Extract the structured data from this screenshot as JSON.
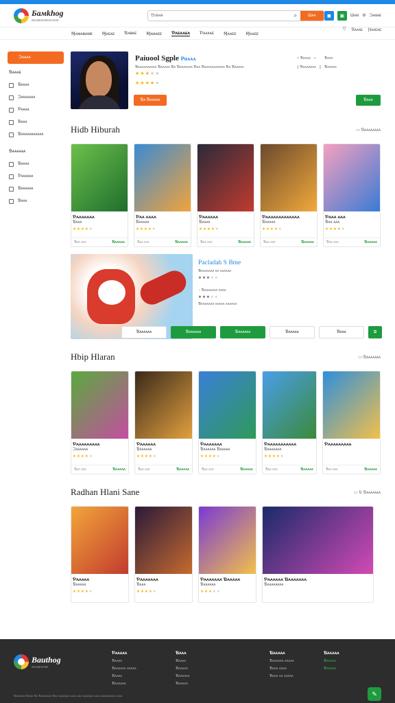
{
  "header": {
    "logo_text": "Бaмkhog",
    "logo_sub": "ʙᴇᴀᴍᴇʀᴀᴍᴇᴡᴀɢᴇᴍ",
    "search_placeholder": "Ծɑᴃᴀᴃ",
    "search_button": "Ɯᴀᴀ",
    "right_labels": [
      "Ɯᴀᴍ",
      "Ɔᴀᴍᴀᴇ"
    ]
  },
  "nav": {
    "items": [
      "Ɱᴀᴍᴀᴃᴀᴍᴇ",
      "Ɱᴀᴇᴀᴇ",
      "Ɓᴀᴃᴀᴇ",
      "Ɱᴀᴍᴀᴇᴇ",
      "Ƥᴀᴇᴀᴀᴇᴀ",
      "Ƥᴀᴀᴀᴀᴇ",
      "Ɱᴀᴀᴇᴇ",
      "Ɱᴀᴀᴇᴇ"
    ],
    "active_index": 4,
    "right": [
      "Ɓᴀᴀᴀᴇ",
      "Ɲᴀᴀᴇᴀᴇ"
    ]
  },
  "sidebar": {
    "active": "Ɔᴀᴀᴀᴀ",
    "section1_title": "Ɓᴀᴀᴀᴇ",
    "section1_items": [
      "Ɓᴀᴀᴀᴀ",
      "Ɔᴀᴀᴀᴀᴀᴀᴀ",
      "Ƥᴀᴀᴀᴀ",
      "Ɓᴀᴀᴀ",
      "Ɓᴀᴀᴀᴀᴀᴀᴀᴀᴀᴀᴀ"
    ],
    "section2_title": "Ɓᴀᴀᴀᴀᴀᴀ",
    "section2_items": [
      "Ɓᴀᴀᴀᴀ",
      "Ƥᴀᴀᴀᴀᴀᴀ",
      "Ɓᴀᴀᴀᴀᴀᴀ",
      "Ɓᴀᴀᴀ"
    ]
  },
  "featured": {
    "title": "Paiuool Sgple",
    "title_tag": "Pɑᴀᴀᴀ",
    "desc": "Ɓᴀᴀᴀᴀᴀᴀᴀᴀᴀᴀ Ɓᴀᴀᴀᴀᴀ Ɓᴀ Ɓᴀᴀᴀᴀᴀᴀᴀ Ɓᴀᴀ Ɓᴀᴀᴀᴀᴀᴀᴀᴀᴀᴀᴀ Ɓᴀ Ɓᴀᴀᴀᴀᴀ",
    "rating": 3,
    "rating2": 4,
    "button": "Ɓᴀ Ɓᴀᴀᴀᴀᴀ",
    "side": [
      "Ɓᴀᴀᴀᴀ",
      "Ɓᴀᴀᴀᴀᴀᴀᴀ",
      "Ɓᴀᴀᴀ",
      "Ɓᴀᴀᴀᴀᴀᴀ"
    ],
    "side_right": [
      "Ɓᴀᴀᴀ",
      "Ɓᴀᴀᴀᴀᴀ"
    ],
    "button_right": "Ɓᴀᴀᴀ"
  },
  "section1": {
    "title": "Hidb Hiburah",
    "more": "Ɓᴀᴀᴀᴀᴀᴀᴀᴀ",
    "cards": [
      {
        "name": "Ƥᴀᴀᴀᴀᴀᴀᴀ",
        "sub": "Ɓᴀᴀᴀ",
        "stars": 4,
        "foot_left": "Ɓᴀᴀ ᴀᴀᴀ",
        "foot_right": "Ɓᴀᴀᴀᴀᴀ",
        "colors": [
          "#6cc04a",
          "#1f6e2e"
        ]
      },
      {
        "name": "Ƥᴀᴀ ᴀᴀᴀᴀ",
        "sub": "Ɓᴀᴀᴀᴀᴀ",
        "stars": 4,
        "foot_left": "Ɓᴀᴀ ᴀᴀᴀ",
        "foot_right": "Ɓᴀᴀᴀᴀᴀ",
        "colors": [
          "#3a8bd4",
          "#f2a33a"
        ]
      },
      {
        "name": "Ƥᴀᴀᴀᴀᴀᴀ",
        "sub": "Ɓᴀᴀᴀᴀ",
        "stars": 4,
        "foot_left": "Ɓᴀᴀ ᴀᴀᴀ",
        "foot_right": "Ɓᴀᴀᴀᴀᴀ",
        "colors": [
          "#2a2a3a",
          "#c23b2e"
        ]
      },
      {
        "name": "Ƥᴀᴀᴀᴀᴀᴀᴀᴀᴀᴀᴀᴀᴀ",
        "sub": "Ɓᴀᴀᴀᴀᴀ",
        "stars": 4,
        "foot_left": "Ɓᴀᴀ ᴀᴀᴀ",
        "foot_right": "Ɓᴀᴀᴀᴀᴀ",
        "colors": [
          "#6b4a2e",
          "#f2a93b"
        ]
      },
      {
        "name": "Ƥᴀᴀᴀ ᴀᴀᴀ",
        "sub": "Ɓᴀᴀ ᴀᴀᴀ",
        "stars": 4,
        "foot_left": "Ɓᴀᴀ ᴀᴀᴀ",
        "foot_right": "Ɓᴀᴀᴀᴀᴀ",
        "colors": [
          "#f4a0c0",
          "#3a7bd4"
        ]
      }
    ]
  },
  "promo": {
    "title": "Pacladah S Bme",
    "line1": "Ɓᴀᴀᴀᴀᴀᴀᴀ ᴀᴀ ᴀᴀᴀᴀᴀᴀ",
    "rating": 3,
    "line2": "Ɓᴀᴀᴀᴀᴀᴀᴀ ᴀᴀᴀᴀ",
    "rating2": 3,
    "line3": "Ɓᴀᴀᴀᴀᴀᴀᴀ ᴀᴀᴀᴀᴀ ᴀᴀᴀᴀᴀᴀ",
    "buttons": [
      "Ɓᴀᴀᴀᴀᴀᴀ",
      "Ɓᴀᴀᴀᴀᴀᴀ",
      "Ɓᴀᴀᴀᴀᴀᴀ",
      "Ɓᴀᴀᴀᴀᴀ",
      "Ɓᴀᴀᴀ"
    ]
  },
  "section2": {
    "title": "Hbip Hlaran",
    "more": "Ɓᴀᴀᴀᴀᴀᴀᴀ",
    "cards": [
      {
        "name": "Ƥᴀᴀᴀᴀᴀᴀᴀᴀᴀ",
        "sub": "Ɔᴀᴀᴀᴀᴀᴀ",
        "stars": 4,
        "foot_left": "Ɓᴀᴀ ᴀᴀᴀ",
        "foot_right": "Ɓᴀᴀᴀᴀᴀ",
        "colors": [
          "#5aaa3e",
          "#c44ea0"
        ]
      },
      {
        "name": "Ƥᴀᴀᴀᴀᴀᴀ",
        "sub": "Ɓᴀᴀᴀᴀᴀᴀ",
        "stars": 4,
        "foot_left": "Ɓᴀᴀ ᴀᴀᴀ",
        "foot_right": "Ɓᴀᴀᴀᴀᴀ",
        "colors": [
          "#3a2a1a",
          "#e2a040"
        ]
      },
      {
        "name": "Ƥᴀᴀᴀᴀᴀᴀᴀ",
        "sub": "Ɓᴀᴀᴀᴀᴀᴀ Ɓᴀᴀᴀᴀᴀ",
        "stars": 4,
        "foot_left": "Ɓᴀᴀ ᴀᴀᴀ",
        "foot_right": "Ɓᴀᴀᴀᴀᴀ",
        "colors": [
          "#3a7fd8",
          "#2e9a5a"
        ]
      },
      {
        "name": "Ƥᴀᴀᴀᴀᴀᴀᴀᴀᴀᴀᴀ",
        "sub": "Ɓᴀᴀᴀᴀᴀᴀᴀ",
        "stars": 4,
        "foot_left": "Ɓᴀᴀ ᴀᴀᴀ",
        "foot_right": "Ɓᴀᴀᴀᴀᴀ",
        "colors": [
          "#4a9ee8",
          "#3a8a3a"
        ]
      },
      {
        "name": "Ƥᴀᴀᴀᴀᴀᴀᴀᴀᴀ",
        "sub": "",
        "stars": 0,
        "foot_left": "Ɓᴀᴀ ᴀᴀᴀ",
        "foot_right": "Ɓᴀᴀᴀᴀᴀ",
        "colors": [
          "#2f8fdb",
          "#f2c04a"
        ]
      }
    ]
  },
  "section3": {
    "title": "Radhan Hlani Sane",
    "more": "Ɓᴀᴀᴀᴀᴀᴀᴀ",
    "cards": [
      {
        "name": "Ƥᴀᴀᴀᴀᴀ",
        "sub": "Ɓᴀᴀᴀᴀᴀ",
        "stars": 4,
        "colors": [
          "#f2a53a",
          "#c23b2e"
        ]
      },
      {
        "name": "Ƥᴀᴀᴀᴀᴀᴀᴀ",
        "sub": "Ɓᴀᴀᴀ",
        "stars": 4,
        "colors": [
          "#2a1a3a",
          "#c66a2e"
        ]
      },
      {
        "name": "Ƥᴀᴀᴀᴀᴀᴀᴀ Ɓᴀᴀᴀᴀᴀ",
        "sub": "Ɓᴀᴀᴀᴀᴀᴀ",
        "stars": 3,
        "colors": [
          "#7a3ad4",
          "#f2c04a"
        ]
      },
      {
        "name": "Ƥᴀᴀᴀᴀᴀᴀ Ɓᴀᴀᴀᴀᴀᴀᴀ",
        "sub": "Ɓᴀᴀᴀᴀᴀᴀᴀᴀ",
        "stars": 0,
        "colors": [
          "#1a2a6a",
          "#d24ab4"
        ]
      }
    ]
  },
  "footer": {
    "logo_text": "Bauthog",
    "logo_sub": "ʙᴇᴀᴍᴇʀᴀᴍᴇ",
    "col1_title": "Ƥᴀᴀᴀᴀᴀ",
    "col1": [
      "Ɓᴀᴀᴀᴀ",
      "Ɓᴀᴀᴀᴀᴀᴀ ᴀᴀᴀᴀᴀ",
      "Ɓᴀᴀᴀᴀ",
      "Ɓᴀᴀᴀᴀᴀᴀ"
    ],
    "col2_title": "Ɓᴀᴀᴀ",
    "col2": [
      "Ɓᴀᴀᴀᴀ",
      "Ɓᴀᴀᴀᴀᴀ",
      "Ɓᴀᴀᴀᴀᴀᴀ",
      "Ɓᴀᴀᴀᴀᴀ"
    ],
    "col3_title": "Ɓᴀᴀᴀᴀᴀ",
    "col3": [
      "Ɓᴀᴀᴀᴀᴀᴀ ᴀᴀᴀᴀᴀ",
      "Ɓᴀᴀᴀ ᴀᴀᴀᴀ",
      "Ɓᴀᴀᴀ ᴀᴀ ᴀᴀᴀᴀᴀ"
    ],
    "col4_title": "Ɓᴀᴀᴀᴀᴀ",
    "col4": [
      "Ɓᴀᴀᴀᴀᴀ",
      "Ɓᴀᴀᴀᴀᴀ"
    ],
    "bottom": "Ɓᴀᴀᴀᴀᴀᴀ  Ɓᴀᴀᴀ  Ɓᴀ Ɓᴀᴀᴀᴀᴀᴀᴀ Ɓᴀᴀ ᴀᴀᴀᴀᴀᴀᴀ ᴀᴀᴀᴀ ᴀᴀᴀ ᴀᴀᴀᴀᴀᴀᴀ ᴀᴀᴀ ᴀᴀᴀᴀᴀᴀᴀᴀᴀᴀ ᴀᴀᴀᴀ"
  },
  "colors": {
    "accent": "#f26b21",
    "green": "#1e9b3e",
    "blue": "#1e88e5",
    "footer_bg": "#2d2d2d"
  }
}
